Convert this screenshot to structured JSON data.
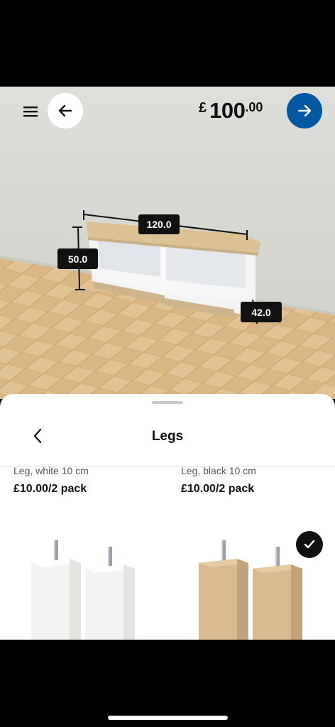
{
  "header": {
    "currency": "£",
    "price_integer": "100",
    "price_decimal": ".00"
  },
  "dimensions": {
    "width": "120.0",
    "height": "50.0",
    "depth": "42.0"
  },
  "sheet": {
    "title": "Legs"
  },
  "products": [
    {
      "name": "Leg, white 10 cm",
      "price": "£10.00/2 pack",
      "selected": false
    },
    {
      "name": "Leg, black 10 cm",
      "price": "£10.00/2 pack",
      "selected": true
    }
  ],
  "icons": {
    "menu": "hamburger-icon",
    "back": "arrow-left-icon",
    "next": "arrow-right-icon",
    "sheet_back": "chevron-left-icon",
    "selected": "checkmark-icon"
  },
  "colors": {
    "accent": "#0058a3",
    "text": "#111111"
  }
}
